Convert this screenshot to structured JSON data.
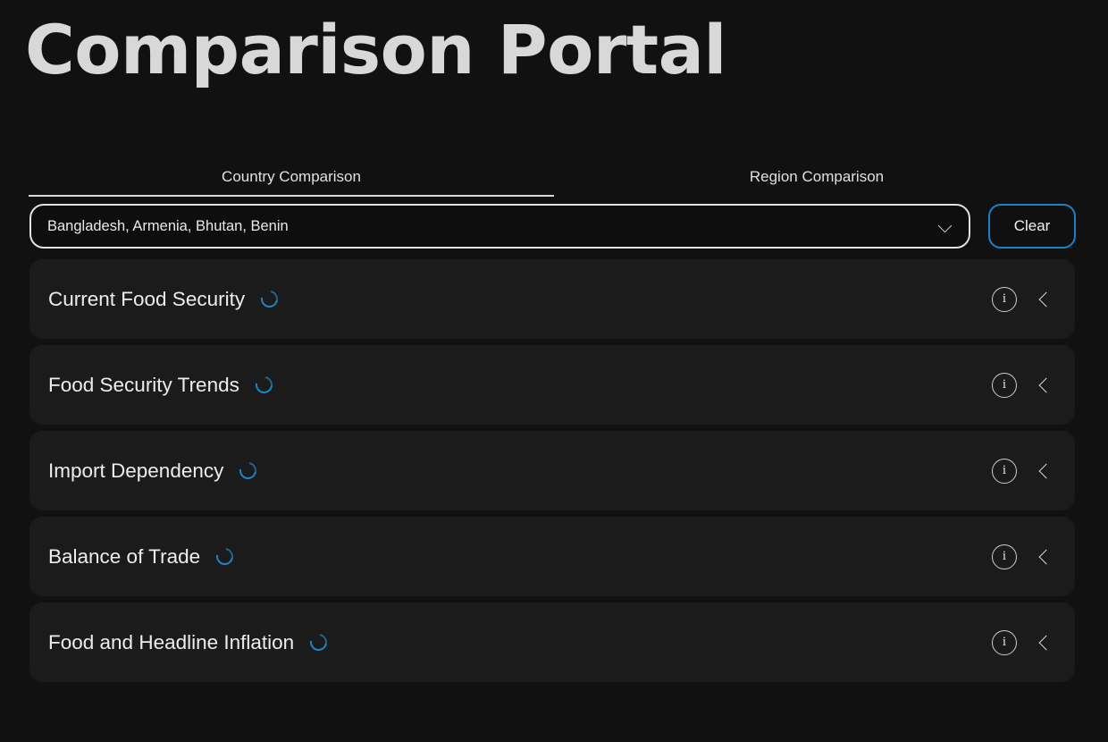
{
  "header": {
    "title": "Comparison Portal"
  },
  "tabs": [
    {
      "label": "Country Comparison",
      "active": true
    },
    {
      "label": "Region Comparison",
      "active": false
    }
  ],
  "selector": {
    "value": "Bangladesh, Armenia, Bhutan, Benin",
    "placeholder": "Select countries",
    "dropdown_icon": "chevron-down-icon",
    "clear_label": "Clear"
  },
  "colors": {
    "background": "#111111",
    "card": "#1b1b1b",
    "accent_blue": "#1f7fc4",
    "spinner_blue": "#2185c5",
    "text": "#ededed",
    "border_light": "#e2e2e2"
  },
  "cards": [
    {
      "title": "Current Food Security",
      "status": "loading",
      "spinner_icon": "loading-spinner-icon",
      "info_icon": "info-icon",
      "info_label": "i",
      "collapse_icon": "chevron-left-icon"
    },
    {
      "title": "Food Security Trends",
      "status": "loading",
      "spinner_icon": "loading-spinner-icon",
      "info_icon": "info-icon",
      "info_label": "i",
      "collapse_icon": "chevron-left-icon"
    },
    {
      "title": "Import Dependency",
      "status": "loading",
      "spinner_icon": "loading-spinner-icon",
      "info_icon": "info-icon",
      "info_label": "i",
      "collapse_icon": "chevron-left-icon"
    },
    {
      "title": "Balance of Trade",
      "status": "loading",
      "spinner_icon": "loading-spinner-icon",
      "info_icon": "info-icon",
      "info_label": "i",
      "collapse_icon": "chevron-left-icon"
    },
    {
      "title": "Food and Headline Inflation",
      "status": "loading",
      "spinner_icon": "loading-spinner-icon",
      "info_icon": "info-icon",
      "info_label": "i",
      "collapse_icon": "chevron-left-icon"
    }
  ]
}
